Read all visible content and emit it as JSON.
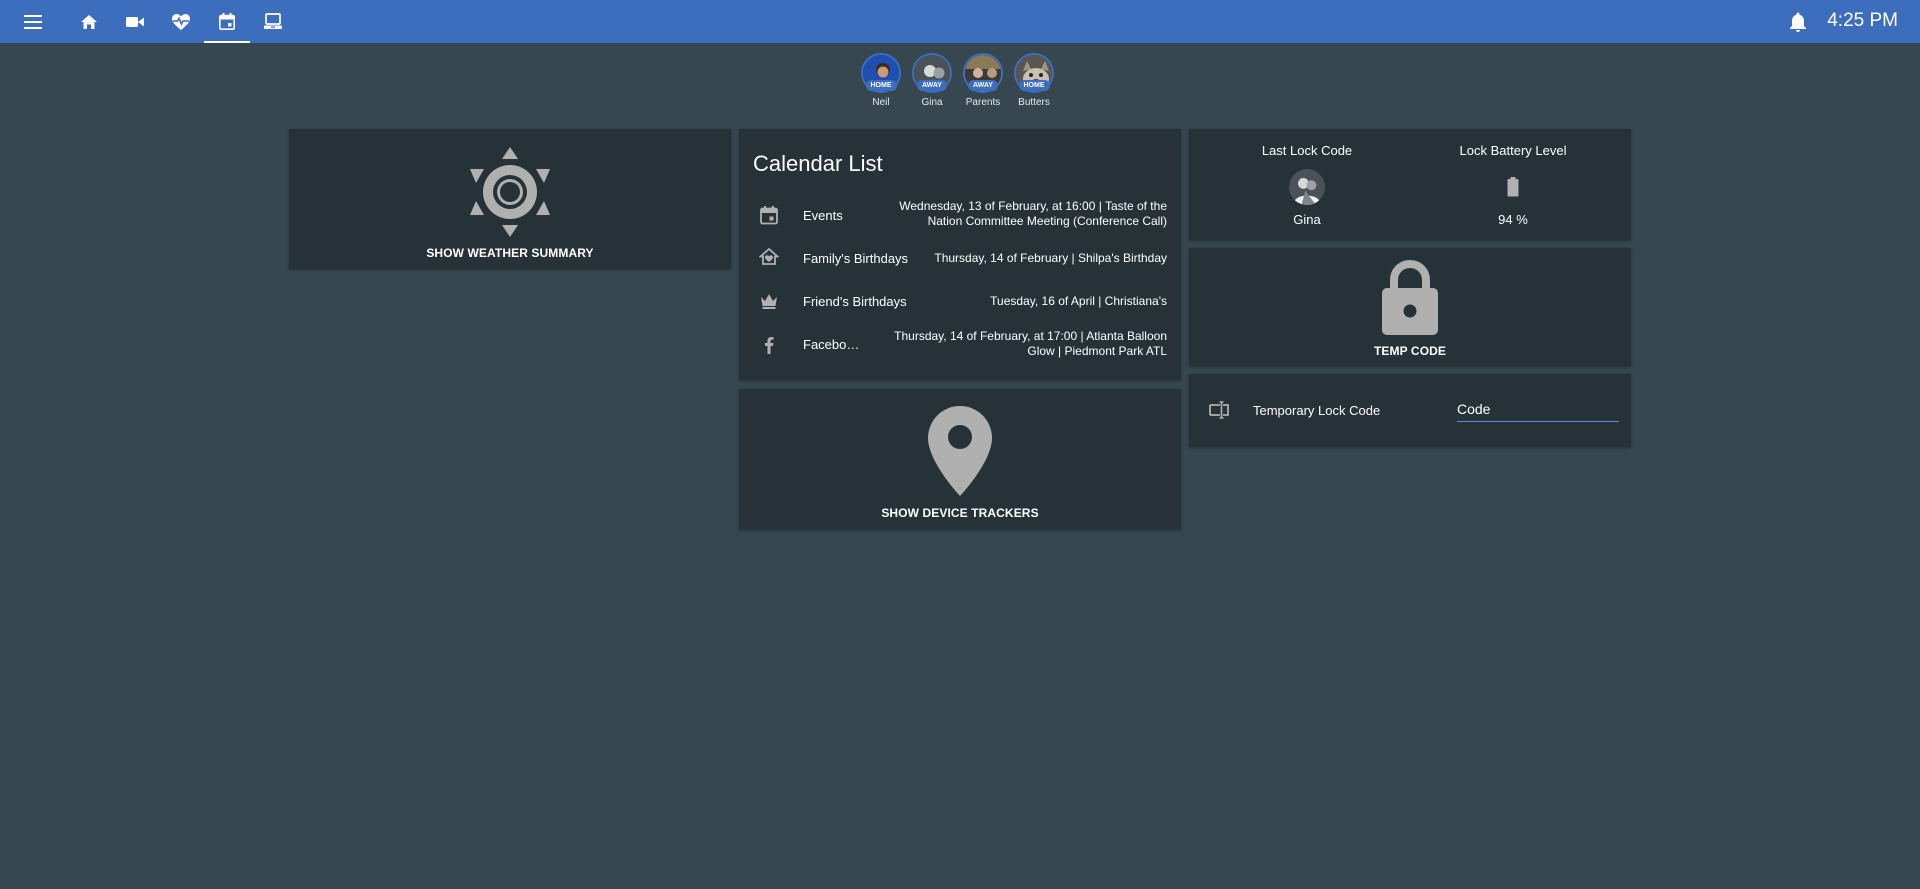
{
  "header": {
    "time": "4:25 PM",
    "tabs": [
      {
        "icon": "home-icon"
      },
      {
        "icon": "video-camera-icon"
      },
      {
        "icon": "heart-pulse-icon"
      },
      {
        "icon": "calendar-icon",
        "active": true
      },
      {
        "icon": "laptop-icon"
      }
    ]
  },
  "people": [
    {
      "name": "Neil",
      "state": "HOME"
    },
    {
      "name": "Gina",
      "state": "AWAY"
    },
    {
      "name": "Parents",
      "state": "AWAY"
    },
    {
      "name": "Butters",
      "state": "HOME"
    }
  ],
  "weather": {
    "label": "SHOW WEATHER SUMMARY"
  },
  "calendar": {
    "title": "Calendar List",
    "rows": [
      {
        "icon": "calendar-icon",
        "label": "Events",
        "value": "Wednesday, 13 of February, at 16:00 | Taste of the Nation Committee Meeting (Conference Call)"
      },
      {
        "icon": "home-heart-icon",
        "label": "Family's Birthdays",
        "value": "Thursday, 14 of February | Shilpa's Birthday"
      },
      {
        "icon": "crown-icon",
        "label": "Friend's Birthdays",
        "value": "Tuesday, 16 of April | Christiana's"
      },
      {
        "icon": "facebook-icon",
        "label": "Facebo…",
        "value": "Thursday, 14 of February, at 17:00 | Atlanta Balloon Glow | Piedmont Park ATL"
      }
    ]
  },
  "trackers": {
    "label": "SHOW DEVICE TRACKERS"
  },
  "lock": {
    "last_code_title": "Last Lock Code",
    "last_code_value": "Gina",
    "battery_title": "Lock Battery Level",
    "battery_value": "94 %",
    "battery_level": 0.94
  },
  "temp_code": {
    "label": "TEMP CODE"
  },
  "temp_lock": {
    "label": "Temporary Lock Code",
    "placeholder": "Code",
    "value": ""
  },
  "colors": {
    "header": "#3d6ebd",
    "background": "#37474f",
    "card": "#263238",
    "icon": "#b0b0b0"
  }
}
